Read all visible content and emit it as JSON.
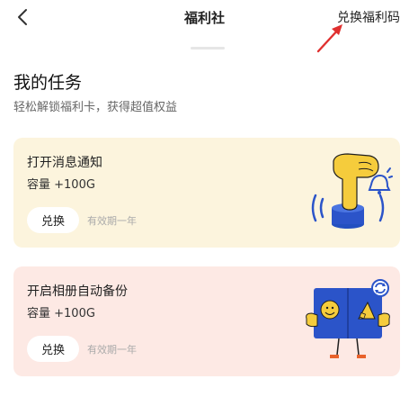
{
  "header": {
    "title": "福利社",
    "redeem_code_label": "兑换福利码",
    "back_icon": "chevron-left-icon"
  },
  "section": {
    "title": "我的任务",
    "subtitle": "轻松解锁福利卡，获得超值权益"
  },
  "tasks": [
    {
      "name": "打开消息通知",
      "reward": "容量 +100G",
      "button_label": "兑换",
      "validity": "有效期一年",
      "illustration": "notification-bell-hand-icon"
    },
    {
      "name": "开启相册自动备份",
      "reward": "容量 +100G",
      "button_label": "兑换",
      "validity": "有效期一年",
      "illustration": "photo-album-sync-icon"
    }
  ],
  "colors": {
    "card_yellow": "#fcf4dd",
    "card_pink": "#fde9e4",
    "accent_blue": "#2b54c9",
    "accent_yellow": "#f5cc3c",
    "arrow_red": "#e0302f"
  }
}
